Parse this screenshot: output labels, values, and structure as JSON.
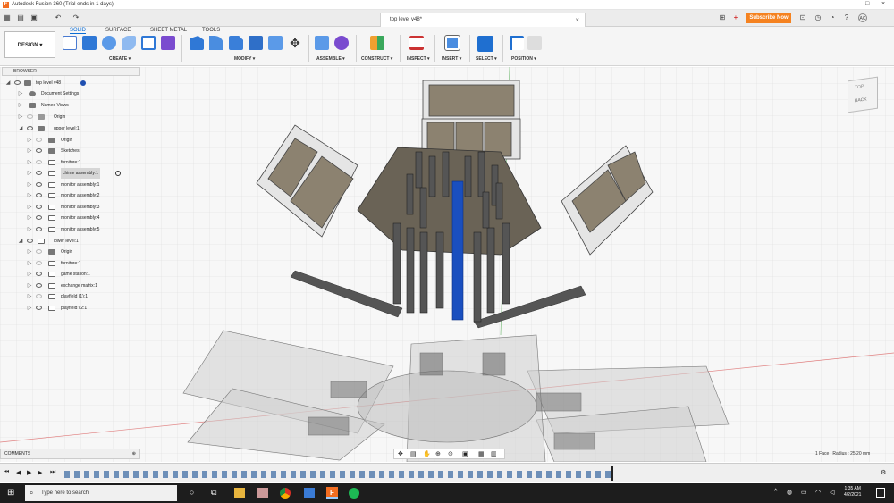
{
  "window": {
    "title": "Autodesk Fusion 360 (Trial ends in 1 days)",
    "doc_tab": "top level v48*",
    "subscribe_label": "Subscribe Now"
  },
  "ribbon": {
    "workspace": "DESIGN",
    "tabs": [
      {
        "label": "SOLID",
        "active": true
      },
      {
        "label": "SURFACE",
        "active": false
      },
      {
        "label": "SHEET METAL",
        "active": false
      },
      {
        "label": "TOOLS",
        "active": false
      }
    ],
    "groups": [
      {
        "label": "CREATE"
      },
      {
        "label": "MODIFY"
      },
      {
        "label": "ASSEMBLE"
      },
      {
        "label": "CONSTRUCT"
      },
      {
        "label": "INSPECT"
      },
      {
        "label": "INSERT"
      },
      {
        "label": "SELECT"
      },
      {
        "label": "POSITION"
      }
    ]
  },
  "browser": {
    "title": "BROWSER",
    "items": [
      {
        "label": "top level v48",
        "indent": 0
      },
      {
        "label": "Document Settings",
        "indent": 1
      },
      {
        "label": "Named Views",
        "indent": 1
      },
      {
        "label": "Origin",
        "indent": 1
      },
      {
        "label": "upper level:1",
        "indent": 1
      },
      {
        "label": "Origin",
        "indent": 2
      },
      {
        "label": "Sketches",
        "indent": 2
      },
      {
        "label": "furniture:1",
        "indent": 2
      },
      {
        "label": "chime assembly:1",
        "indent": 2
      },
      {
        "label": "monitor assembly:1",
        "indent": 2
      },
      {
        "label": "monitor assembly:2",
        "indent": 2
      },
      {
        "label": "monitor assembly:3",
        "indent": 2
      },
      {
        "label": "monitor assembly:4",
        "indent": 2
      },
      {
        "label": "monitor assembly:5",
        "indent": 2
      },
      {
        "label": "lower level:1",
        "indent": 1
      },
      {
        "label": "Origin",
        "indent": 2
      },
      {
        "label": "furniture:1",
        "indent": 2
      },
      {
        "label": "game station:1",
        "indent": 2
      },
      {
        "label": "exchange matrix:1",
        "indent": 2
      },
      {
        "label": "playfield (1):1",
        "indent": 2
      },
      {
        "label": "playfield v2:1",
        "indent": 2
      }
    ]
  },
  "viewcube": {
    "face": "BACK",
    "top": "TOP"
  },
  "comments": {
    "label": "COMMENTS"
  },
  "status": {
    "right": "1 Face | Radius : 25.20 mm"
  },
  "taskbar": {
    "search_placeholder": "Type here to search",
    "time": "1:35 AM",
    "date": "4/2/2021"
  },
  "colors": {
    "accent": "#0a6cd4",
    "subscribe": "#f58220",
    "chime_tube": "#1a4fbf"
  }
}
